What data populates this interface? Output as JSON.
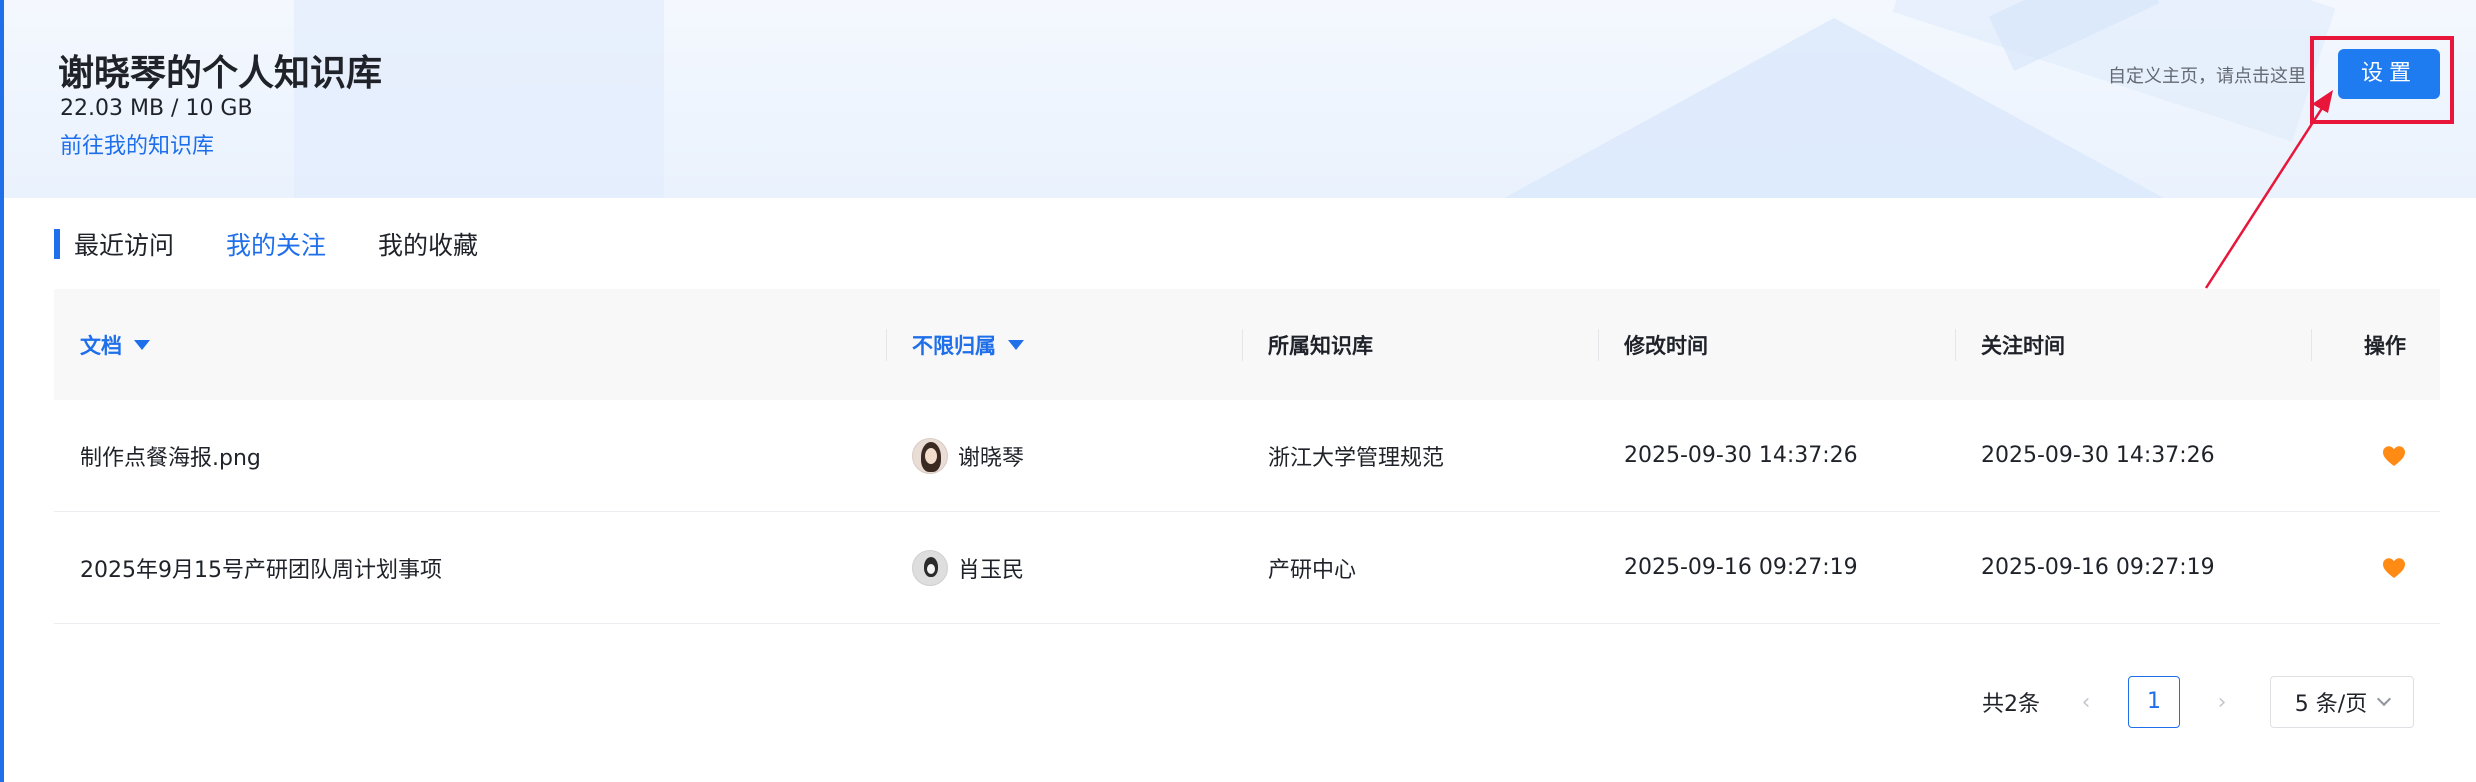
{
  "header": {
    "title": "谢晓琴的个人知识库",
    "usage": "22.03 MB / 10 GB",
    "goto_link": "前往我的知识库",
    "customize_hint": "自定义主页，请点击这里",
    "settings_label": "设置"
  },
  "tabs": [
    {
      "label": "最近访问",
      "active": false
    },
    {
      "label": "我的关注",
      "active": true
    },
    {
      "label": "我的收藏",
      "active": false
    }
  ],
  "table": {
    "columns": [
      "文档",
      "不限归属",
      "所属知识库",
      "修改时间",
      "关注时间",
      "操作"
    ],
    "rows": [
      {
        "document": "制作点餐海报.png",
        "owner": "谢晓琴",
        "knowledge_base": "浙江大学管理规范",
        "modified": "2025-09-30 14:37:26",
        "followed": "2025-09-30 14:37:26",
        "action_icon": "heart-icon"
      },
      {
        "document": "2025年9月15号产研团队周计划事项",
        "owner": "肖玉民",
        "knowledge_base": "产研中心",
        "modified": "2025-09-16 09:27:19",
        "followed": "2025-09-16 09:27:19",
        "action_icon": "heart-icon"
      }
    ]
  },
  "pagination": {
    "total": "共2条",
    "current_page": "1",
    "page_size": "5 条/页"
  },
  "colors": {
    "accent": "#1f6feb",
    "button": "#1f7cf0",
    "heart": "#ff8a14",
    "annotation": "#e8163a"
  }
}
